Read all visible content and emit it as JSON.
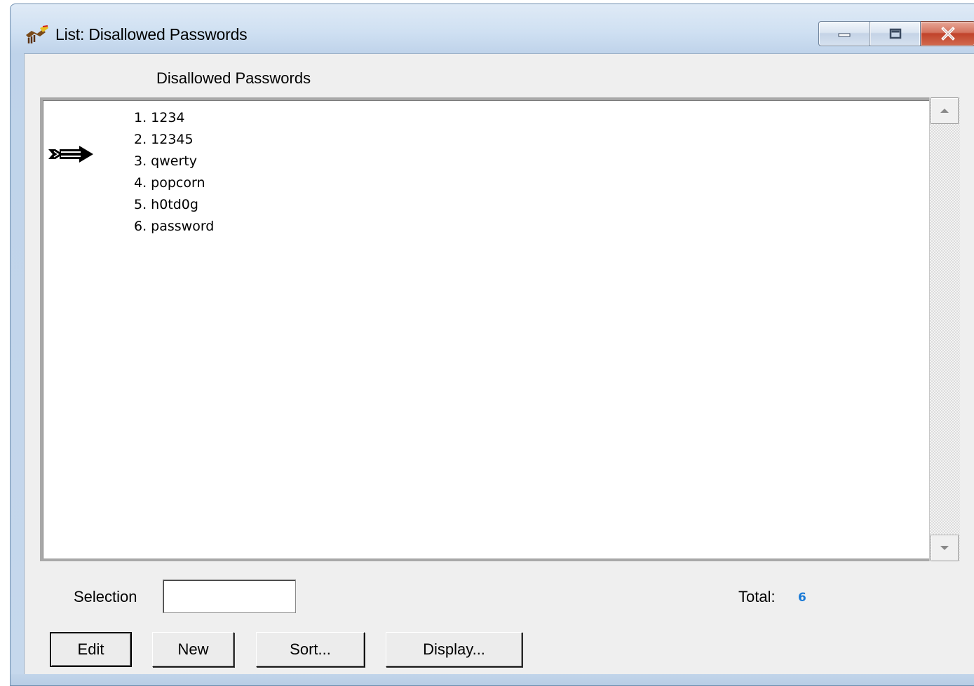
{
  "window": {
    "title": "List: Disallowed Passwords",
    "controls": {
      "minimize_icon": "minimize-icon",
      "maximize_icon": "maximize-icon",
      "close_icon": "close-icon"
    }
  },
  "list": {
    "header": "Disallowed Passwords",
    "items": [
      {
        "label": "1. 1234"
      },
      {
        "label": "2. 12345"
      },
      {
        "label": "3. qwerty"
      },
      {
        "label": "4. popcorn"
      },
      {
        "label": "5. h0td0g"
      },
      {
        "label": "6. password"
      }
    ],
    "pointer_icon": "arrow-pointer-icon"
  },
  "footer": {
    "selection_label": "Selection",
    "selection_value": "",
    "total_label": "Total:",
    "total_value": "6"
  },
  "buttons": {
    "edit": "Edit",
    "new": "New",
    "sort": "Sort...",
    "display": "Display..."
  },
  "colors": {
    "total_value": "#1a7ad6",
    "close_button": "#c0432b",
    "title_bar": "#cfe0f2"
  }
}
